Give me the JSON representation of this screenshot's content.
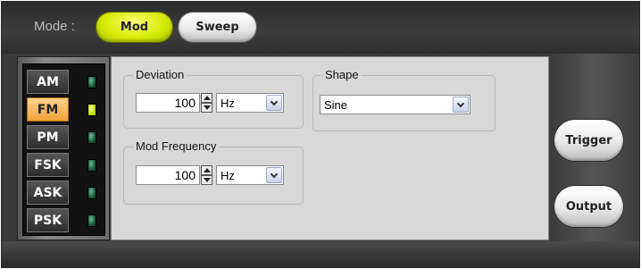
{
  "mode_bar": {
    "label": "Mode :",
    "tabs": [
      {
        "label": "Mod",
        "selected": true
      },
      {
        "label": "Sweep",
        "selected": false
      }
    ]
  },
  "modulation_types": [
    {
      "label": "AM",
      "active": false
    },
    {
      "label": "FM",
      "active": true
    },
    {
      "label": "PM",
      "active": false
    },
    {
      "label": "FSK",
      "active": false
    },
    {
      "label": "ASK",
      "active": false
    },
    {
      "label": "PSK",
      "active": false
    }
  ],
  "deviation": {
    "title": "Deviation",
    "value": "100",
    "unit": "Hz"
  },
  "mod_frequency": {
    "title": "Mod Frequency",
    "value": "100",
    "unit": "Hz"
  },
  "shape": {
    "title": "Shape",
    "value": "Sine"
  },
  "actions": {
    "trigger_label": "Trigger",
    "output_label": "Output"
  },
  "colors": {
    "selected_tab": "#d6ec06",
    "active_mod": "#f0a23c",
    "led_on": "#b6d400",
    "led_off": "#0d4a33"
  }
}
